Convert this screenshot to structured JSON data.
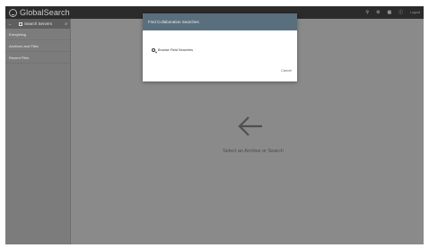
{
  "app": {
    "title": "GlobalSearch"
  },
  "topbar": {
    "icons": [
      "filter-icon",
      "settings-icon",
      "grid-icon",
      "info-icon"
    ],
    "user_link": "Logout"
  },
  "sidebar": {
    "header_label": "Search Servers",
    "items": [
      {
        "label": "Everything"
      },
      {
        "label": "Archives and Files"
      },
      {
        "label": "Recent Files"
      }
    ]
  },
  "main": {
    "empty_message": "Select an Archive or Search"
  },
  "modal": {
    "title": "Find Collaboration Searches",
    "option_label": "Browse Field Searches",
    "cancel_label": "Cancel"
  }
}
